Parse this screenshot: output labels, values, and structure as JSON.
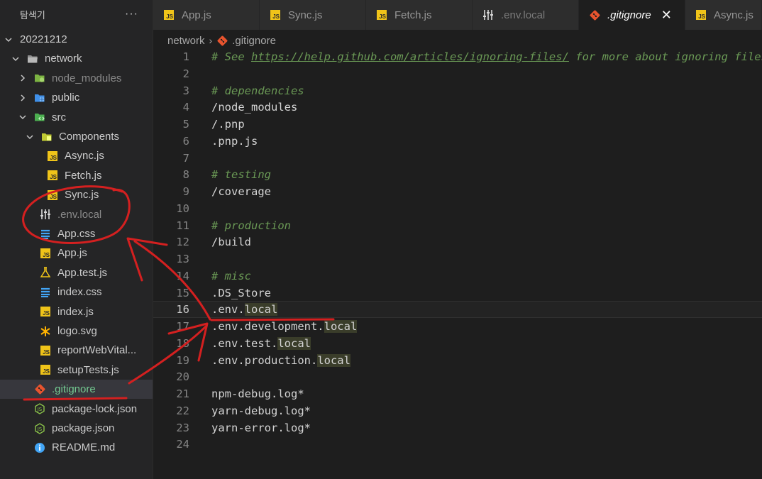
{
  "sidebar": {
    "title": "탐색기",
    "more": "···",
    "tree": [
      {
        "label": "20221212",
        "indent": 0,
        "chevron": "down",
        "icon": "none",
        "style": "normal"
      },
      {
        "label": "network",
        "indent": 1,
        "chevron": "down",
        "icon": "folder-open-icon",
        "style": "normal"
      },
      {
        "label": "node_modules",
        "indent": 2,
        "chevron": "right",
        "icon": "node-folder-icon",
        "style": "dim"
      },
      {
        "label": "public",
        "indent": 2,
        "chevron": "right",
        "icon": "public-folder-icon",
        "style": "normal"
      },
      {
        "label": "src",
        "indent": 2,
        "chevron": "down",
        "icon": "src-folder-icon",
        "style": "normal"
      },
      {
        "label": "Components",
        "indent": 3,
        "chevron": "down",
        "icon": "components-folder-icon",
        "style": "normal"
      },
      {
        "label": "Async.js",
        "indent": 4,
        "chevron": "none",
        "icon": "js-file-icon",
        "style": "normal"
      },
      {
        "label": "Fetch.js",
        "indent": 4,
        "chevron": "none",
        "icon": "js-file-icon",
        "style": "normal"
      },
      {
        "label": "Sync.js",
        "indent": 4,
        "chevron": "none",
        "icon": "js-file-icon",
        "style": "normal"
      },
      {
        "label": ".env.local",
        "indent": 3,
        "chevron": "none",
        "icon": "env-file-icon",
        "style": "dim"
      },
      {
        "label": "App.css",
        "indent": 3,
        "chevron": "none",
        "icon": "css-file-icon",
        "style": "normal"
      },
      {
        "label": "App.js",
        "indent": 3,
        "chevron": "none",
        "icon": "js-file-icon",
        "style": "normal"
      },
      {
        "label": "App.test.js",
        "indent": 3,
        "chevron": "none",
        "icon": "test-file-icon",
        "style": "normal"
      },
      {
        "label": "index.css",
        "indent": 3,
        "chevron": "none",
        "icon": "css-file-icon",
        "style": "normal"
      },
      {
        "label": "index.js",
        "indent": 3,
        "chevron": "none",
        "icon": "js-file-icon",
        "style": "normal"
      },
      {
        "label": "logo.svg",
        "indent": 3,
        "chevron": "none",
        "icon": "svg-file-icon",
        "style": "normal"
      },
      {
        "label": "reportWebVital...",
        "indent": 3,
        "chevron": "none",
        "icon": "js-file-icon",
        "style": "normal"
      },
      {
        "label": "setupTests.js",
        "indent": 3,
        "chevron": "none",
        "icon": "js-file-icon",
        "style": "normal"
      },
      {
        "label": ".gitignore",
        "indent": 2,
        "chevron": "none",
        "icon": "git-file-icon",
        "style": "git",
        "selected": true
      },
      {
        "label": "package-lock.json",
        "indent": 2,
        "chevron": "none",
        "icon": "json-file-icon",
        "style": "normal"
      },
      {
        "label": "package.json",
        "indent": 2,
        "chevron": "none",
        "icon": "json-file-icon",
        "style": "normal"
      },
      {
        "label": "README.md",
        "indent": 2,
        "chevron": "none",
        "icon": "info-file-icon",
        "style": "normal"
      }
    ]
  },
  "tabs": [
    {
      "label": "App.js",
      "icon": "js-file-icon",
      "active": false,
      "dim": false
    },
    {
      "label": "Sync.js",
      "icon": "js-file-icon",
      "active": false,
      "dim": false
    },
    {
      "label": "Fetch.js",
      "icon": "js-file-icon",
      "active": false,
      "dim": false
    },
    {
      "label": ".env.local",
      "icon": "env-file-icon",
      "active": false,
      "dim": true
    },
    {
      "label": ".gitignore",
      "icon": "git-file-icon",
      "active": true,
      "dim": false,
      "close": "✕"
    },
    {
      "label": "Async.js",
      "icon": "js-file-icon",
      "active": false,
      "dim": false
    }
  ],
  "breadcrumb": {
    "folder": "network",
    "separator": "›",
    "file": ".gitignore"
  },
  "editor": {
    "current_line": 16,
    "lines": [
      {
        "n": "1",
        "kind": "comment",
        "parts": [
          {
            "t": "# See "
          },
          {
            "t": "https://help.github.com/articles/ignoring-files/",
            "url": true
          },
          {
            "t": " for more about ignoring files."
          }
        ]
      },
      {
        "n": "2",
        "kind": "code",
        "parts": []
      },
      {
        "n": "3",
        "kind": "comment",
        "parts": [
          {
            "t": "# dependencies"
          }
        ]
      },
      {
        "n": "4",
        "kind": "code",
        "parts": [
          {
            "t": "/node_modules"
          }
        ]
      },
      {
        "n": "5",
        "kind": "code",
        "parts": [
          {
            "t": "/.pnp"
          }
        ]
      },
      {
        "n": "6",
        "kind": "code",
        "parts": [
          {
            "t": ".pnp.js"
          }
        ]
      },
      {
        "n": "7",
        "kind": "code",
        "parts": []
      },
      {
        "n": "8",
        "kind": "comment",
        "parts": [
          {
            "t": "# testing"
          }
        ]
      },
      {
        "n": "9",
        "kind": "code",
        "parts": [
          {
            "t": "/coverage"
          }
        ]
      },
      {
        "n": "10",
        "kind": "code",
        "parts": []
      },
      {
        "n": "11",
        "kind": "comment",
        "parts": [
          {
            "t": "# production"
          }
        ]
      },
      {
        "n": "12",
        "kind": "code",
        "parts": [
          {
            "t": "/build"
          }
        ]
      },
      {
        "n": "13",
        "kind": "code",
        "parts": []
      },
      {
        "n": "14",
        "kind": "comment",
        "parts": [
          {
            "t": "# misc"
          }
        ]
      },
      {
        "n": "15",
        "kind": "code",
        "parts": [
          {
            "t": ".DS_Store"
          }
        ]
      },
      {
        "n": "16",
        "kind": "code",
        "parts": [
          {
            "t": ".env."
          },
          {
            "t": "local",
            "hl": true
          }
        ]
      },
      {
        "n": "17",
        "kind": "code",
        "parts": [
          {
            "t": ".env.development."
          },
          {
            "t": "local",
            "hl": true
          }
        ]
      },
      {
        "n": "18",
        "kind": "code",
        "parts": [
          {
            "t": ".env.test."
          },
          {
            "t": "local",
            "hl": true
          }
        ]
      },
      {
        "n": "19",
        "kind": "code",
        "parts": [
          {
            "t": ".env.production."
          },
          {
            "t": "local",
            "hl": true
          }
        ]
      },
      {
        "n": "20",
        "kind": "code",
        "parts": []
      },
      {
        "n": "21",
        "kind": "code",
        "parts": [
          {
            "t": "npm-debug.log*"
          }
        ]
      },
      {
        "n": "22",
        "kind": "code",
        "parts": [
          {
            "t": "yarn-debug.log*"
          }
        ]
      },
      {
        "n": "23",
        "kind": "code",
        "parts": [
          {
            "t": "yarn-error.log*"
          }
        ]
      },
      {
        "n": "24",
        "kind": "code",
        "parts": []
      }
    ]
  },
  "colors": {
    "annotation": "#d42020",
    "git_green": "#73c991",
    "comment_green": "#6a9955",
    "js_yellow": "#f0c419"
  }
}
